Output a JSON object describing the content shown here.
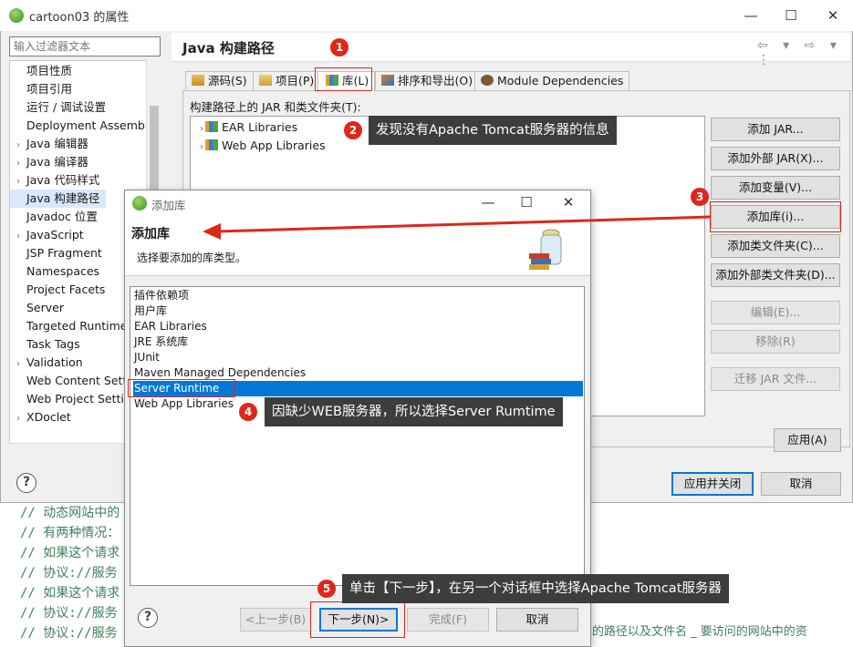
{
  "window": {
    "title": "cartoon03 的属性",
    "controls": [
      "—",
      "☐",
      "✕"
    ]
  },
  "filter": {
    "placeholder": "输入过滤器文本"
  },
  "sidebar": {
    "items": [
      {
        "label": "项目性质",
        "arrow": ""
      },
      {
        "label": "项目引用",
        "arrow": ""
      },
      {
        "label": "运行 / 调试设置",
        "arrow": ""
      },
      {
        "label": "Deployment Assembly",
        "arrow": ""
      },
      {
        "label": "Java 编辑器",
        "arrow": "›"
      },
      {
        "label": "Java 编译器",
        "arrow": "›"
      },
      {
        "label": "Java 代码样式",
        "arrow": "›"
      },
      {
        "label": "Java 构建路径",
        "arrow": "",
        "selected": true
      },
      {
        "label": "Javadoc 位置",
        "arrow": ""
      },
      {
        "label": "JavaScript",
        "arrow": "›"
      },
      {
        "label": "JSP Fragment",
        "arrow": ""
      },
      {
        "label": "Namespaces",
        "arrow": ""
      },
      {
        "label": "Project Facets",
        "arrow": ""
      },
      {
        "label": "Server",
        "arrow": ""
      },
      {
        "label": "Targeted Runtimes",
        "arrow": ""
      },
      {
        "label": "Task Tags",
        "arrow": ""
      },
      {
        "label": "Validation",
        "arrow": "›"
      },
      {
        "label": "Web Content Settings",
        "arrow": ""
      },
      {
        "label": "Web Project Settings",
        "arrow": ""
      },
      {
        "label": "XDoclet",
        "arrow": "›"
      }
    ]
  },
  "page": {
    "title": "Java 构建路径",
    "nav": "⇦ ▾ ⇨ ▾ ⋮",
    "tabs": [
      {
        "label": "源码(S)"
      },
      {
        "label": "项目(P)"
      },
      {
        "label": "库(L)",
        "active": true
      },
      {
        "label": "排序和导出(O)"
      },
      {
        "label": "Module Dependencies"
      }
    ],
    "jar_label": "构建路径上的 JAR 和类文件夹(T):",
    "entries": [
      "EAR Libraries",
      "Web App Libraries"
    ],
    "buttons": {
      "add_jar": "添加 JAR...",
      "add_ext_jar": "添加外部 JAR(X)...",
      "add_var": "添加变量(V)...",
      "add_lib": "添加库(i)...",
      "add_class_folder": "添加类文件夹(C)...",
      "add_ext_class_folder": "添加外部类文件夹(D)...",
      "edit": "编辑(E)...",
      "remove": "移除(R)",
      "migrate": "迁移 JAR 文件..."
    },
    "apply": "应用(A)",
    "apply_close": "应用并关闭",
    "cancel": "取消",
    "help": "?"
  },
  "dialog": {
    "title": "添加库",
    "controls": [
      "—",
      "☐",
      "✕"
    ],
    "heading": "添加库",
    "subtitle": "选择要添加的库类型。",
    "items": [
      {
        "label": "插件依赖项"
      },
      {
        "label": "用户库"
      },
      {
        "label": "EAR Libraries"
      },
      {
        "label": "JRE 系统库"
      },
      {
        "label": "JUnit"
      },
      {
        "label": "Maven Managed Dependencies"
      },
      {
        "label": "Server Runtime",
        "selected": true
      },
      {
        "label": "Web App Libraries"
      }
    ],
    "buttons": {
      "back": "<上一步(B)",
      "next": "下一步(N)>",
      "finish": "完成(F)",
      "cancel": "取消"
    },
    "help": "?"
  },
  "annotations": {
    "badges": [
      "1",
      "2",
      "3",
      "4",
      "5"
    ],
    "callout2": "发现没有Apache Tomcat服务器的信息",
    "callout4": "因缺少WEB服务器，所以选择Server Rumtime",
    "callout5": "单击【下一步】，在另一个对话框中选择Apache Tomcat服务器"
  },
  "code": {
    "lines": [
      "//  动态网站中的",
      "//  有两种情况：",
      "//  如果这个请求",
      "//  协议://服务",
      "//  如果这个请求",
      "//  协议://服务",
      "//  协议://服务"
    ],
    "tail": "本的路径以及文件名  _  要访问的网站中的资"
  },
  "colors": {
    "accent": "#0078d7",
    "annotation_red": "#e0261a",
    "callout_bg": "#3d3d3d",
    "comment_green": "#3f7f5f"
  }
}
